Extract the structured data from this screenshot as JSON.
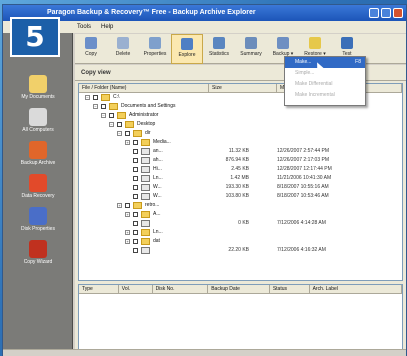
{
  "window": {
    "title": "Paragon Backup & Recovery™ Free - Backup Archive Explorer"
  },
  "badge": "5",
  "menubar": [
    "Tools",
    "Help"
  ],
  "toolbar": [
    {
      "label": "Copy",
      "icon": "copy-icon",
      "color": "#6b8fc9"
    },
    {
      "label": "Delete",
      "icon": "delete-icon",
      "color": "#9ab0d0"
    },
    {
      "label": "Properties",
      "icon": "properties-icon",
      "color": "#7fa0cc"
    },
    {
      "label": "Explore",
      "icon": "explore-icon",
      "color": "#4f7fc4",
      "active": true
    },
    {
      "label": "Statistics",
      "icon": "statistics-icon",
      "color": "#5a86c0"
    },
    {
      "label": "Summary",
      "icon": "summary-icon",
      "color": "#6c8dbb"
    },
    {
      "label": "Backup",
      "icon": "backup-icon",
      "color": "#6e8fc2",
      "caret": "▾"
    },
    {
      "label": "Restore",
      "icon": "restore-icon",
      "color": "#e6c84a",
      "caret": "▾"
    },
    {
      "label": "Test",
      "icon": "test-icon",
      "color": "#3b6fb8"
    }
  ],
  "sidebar": [
    {
      "label": "My Documents",
      "icon": "folder-icon",
      "color": "#f1d06a"
    },
    {
      "label": "All Computers",
      "icon": "computer-icon",
      "color": "#dadada"
    },
    {
      "label": "Backup Archive",
      "icon": "archive-icon",
      "color": "#e0662a"
    },
    {
      "label": "Data Recovery",
      "icon": "recovery-icon",
      "color": "#e24a2a"
    },
    {
      "label": "Disk Properties",
      "icon": "network-icon",
      "color": "#4a6ec8"
    },
    {
      "label": "Copy Wizard",
      "icon": "wizard-icon",
      "color": "#c0311f"
    }
  ],
  "main": {
    "header": "Copy view",
    "tree_columns": [
      "File / Folder (Name)",
      "Size",
      "Modified"
    ],
    "tree": [
      {
        "indent": 0,
        "label": "C:\\",
        "type": "folder",
        "expanded": true
      },
      {
        "indent": 1,
        "label": "Documents and Settings",
        "type": "folder",
        "expanded": true
      },
      {
        "indent": 2,
        "label": "Administrator",
        "type": "folder",
        "expanded": true
      },
      {
        "indent": 3,
        "label": "Desktop",
        "type": "folder",
        "expanded": true
      },
      {
        "indent": 4,
        "label": "dir",
        "type": "folder",
        "expanded": true
      },
      {
        "indent": 5,
        "label": "Media...",
        "type": "folder"
      },
      {
        "indent": 5,
        "label": "an...",
        "type": "file",
        "size": "11.32 KB",
        "date": "12/26/2007 2:57:44 PM"
      },
      {
        "indent": 5,
        "label": "ah...",
        "type": "file",
        "size": "876.94 KB",
        "date": "12/26/2007 2:17:03 PM"
      },
      {
        "indent": 5,
        "label": "Hi...",
        "type": "file",
        "size": "2.45 KB",
        "date": "12/28/2007 12:17:44 PM"
      },
      {
        "indent": 5,
        "label": "Ln...",
        "type": "file",
        "size": "1.42 MB",
        "date": "11/21/2006 10:41:30 AM"
      },
      {
        "indent": 5,
        "label": "W...",
        "type": "file",
        "size": "193.30 KB",
        "date": "8/18/2007 10:55:16 AM"
      },
      {
        "indent": 5,
        "label": "W...",
        "type": "file",
        "size": "103.80 KB",
        "date": "8/18/2007 10:53:46 AM"
      },
      {
        "indent": 4,
        "label": "retro...",
        "type": "folder"
      },
      {
        "indent": 5,
        "label": "A...",
        "type": "folder"
      },
      {
        "indent": 5,
        "label": "",
        "type": "file",
        "size": "0 KB",
        "date": "7/12/2006 4:14:28 AM"
      },
      {
        "indent": 5,
        "label": "Ln...",
        "type": "folder"
      },
      {
        "indent": 5,
        "label": "dat",
        "type": "folder"
      },
      {
        "indent": 5,
        "label": "",
        "type": "file",
        "size": "22.20 KB",
        "date": "7/12/2006 4:16:32 AM"
      }
    ],
    "detail_columns": [
      "Type",
      "Vol.",
      "Disk No.",
      "Backup Date",
      "Status",
      "Arch. Label"
    ]
  },
  "dropdown": [
    {
      "label": "Make...",
      "key": "F8",
      "selected": true
    },
    {
      "label": "Simple...",
      "key": ""
    },
    {
      "label": "Make Differential",
      "key": ""
    },
    {
      "label": "Make Incremental",
      "key": ""
    }
  ],
  "colors": {
    "selection": "#316ac5",
    "sidebar": "#7b7b78",
    "badge": "#1c5fa8"
  }
}
